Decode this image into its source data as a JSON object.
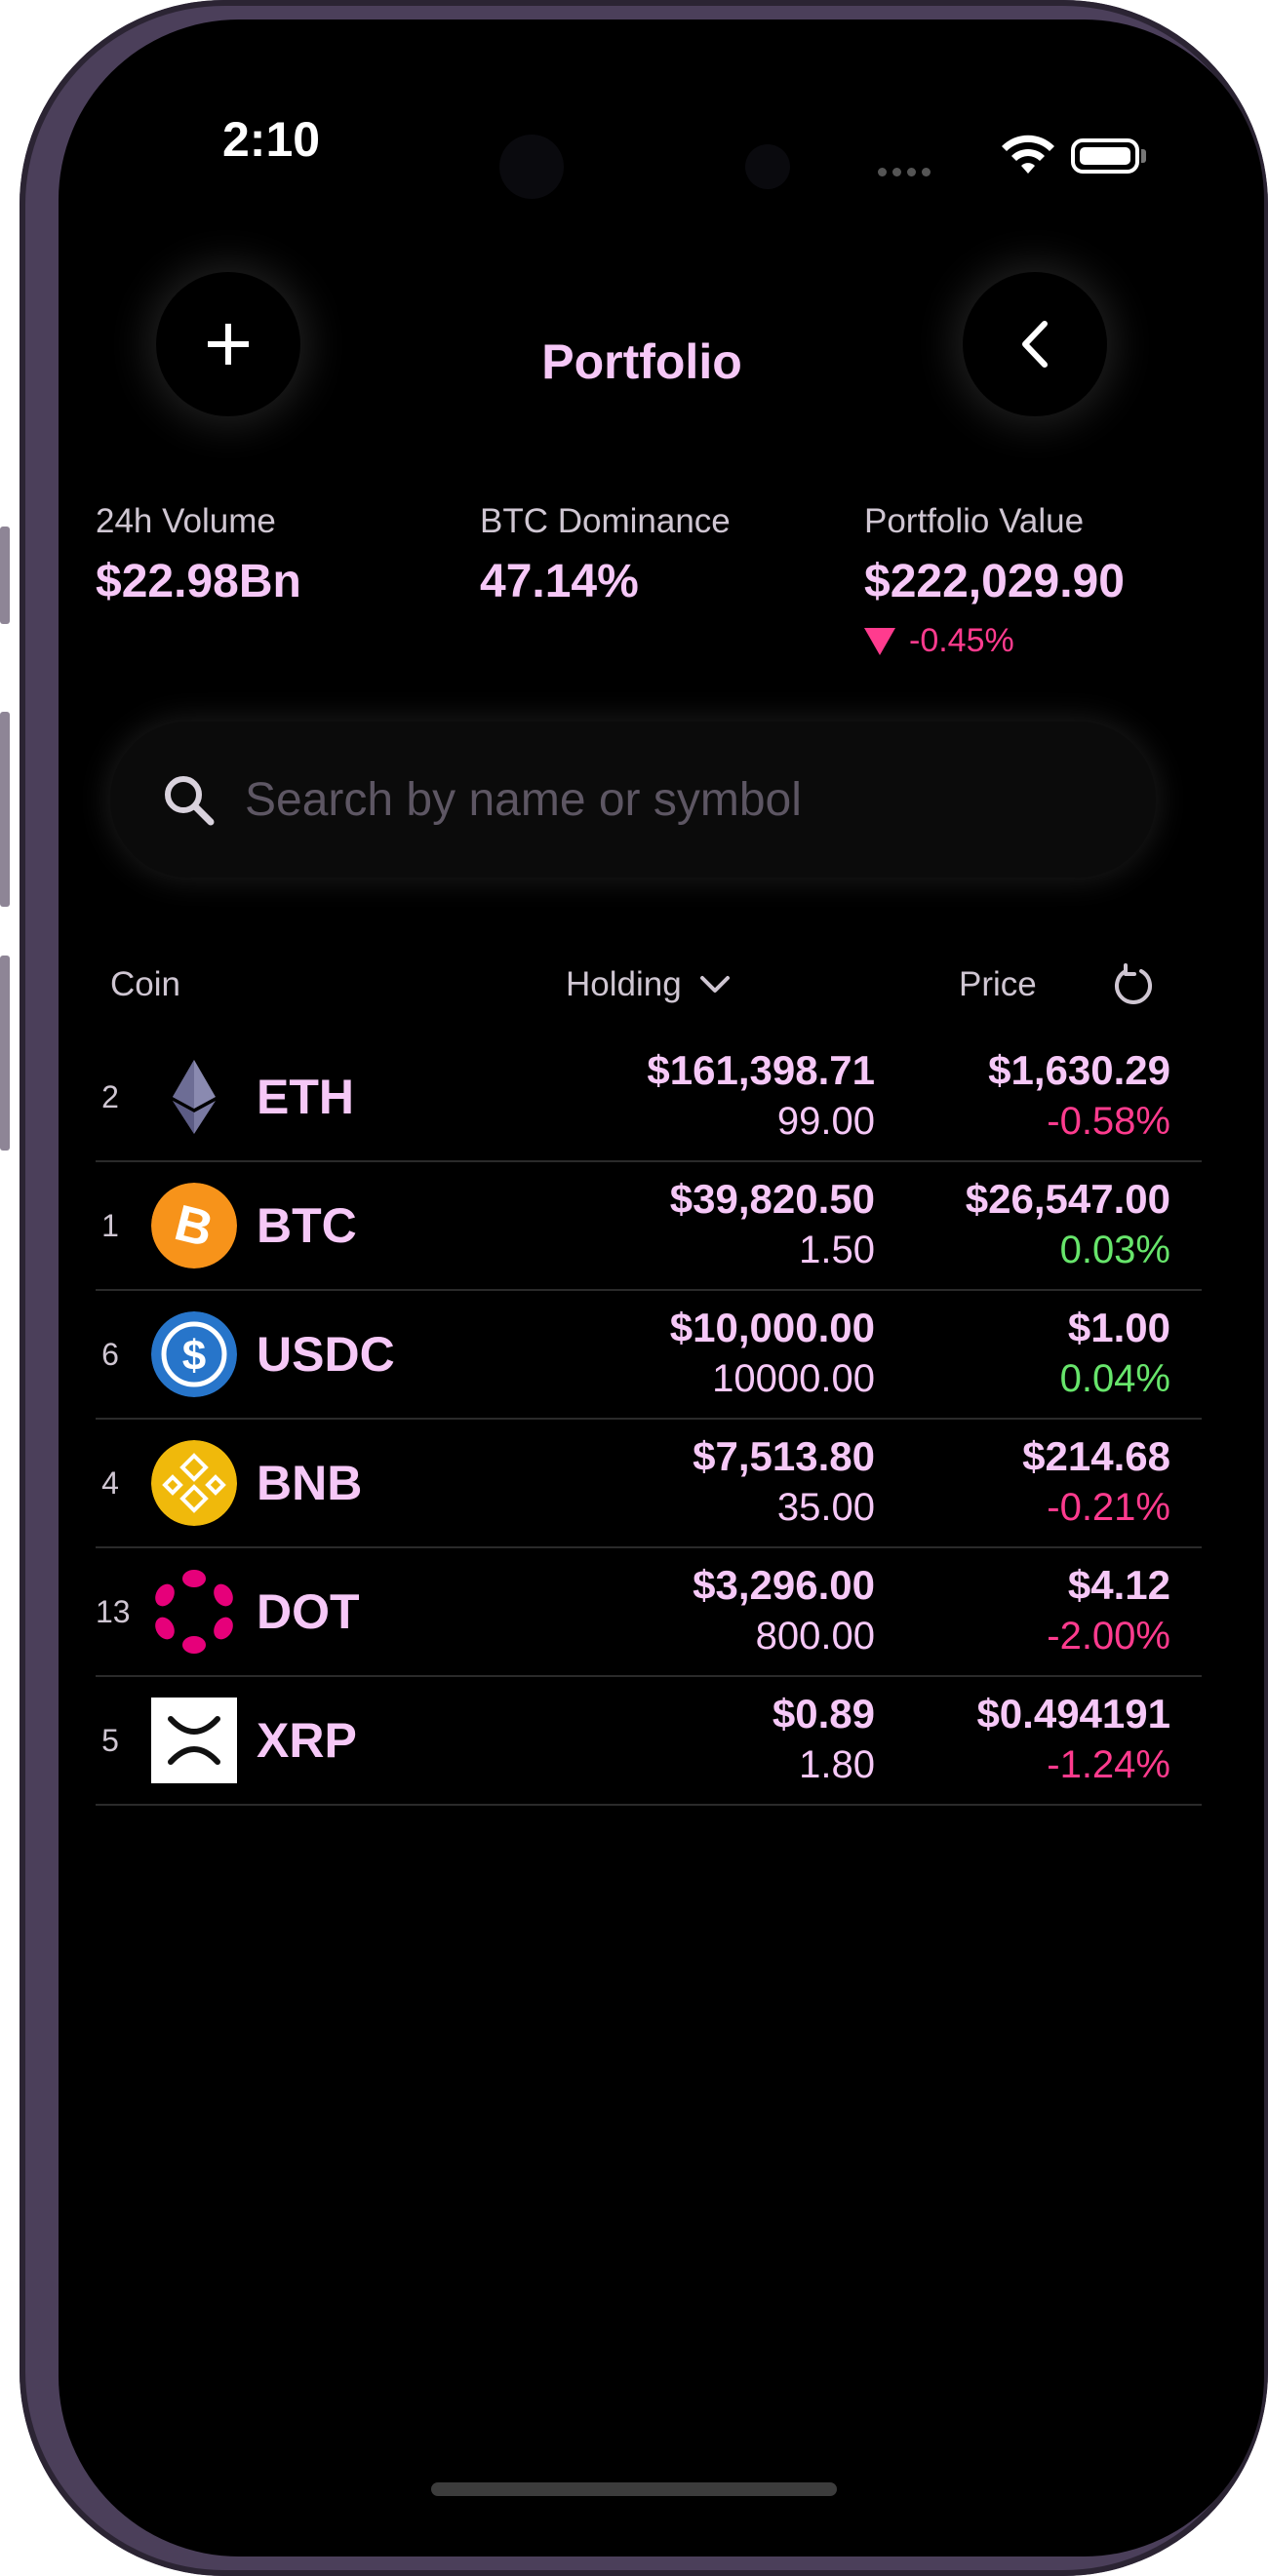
{
  "status": {
    "time": "2:10"
  },
  "header": {
    "title": "Portfolio",
    "add_icon": "plus-icon",
    "back_icon": "chevron-left-icon"
  },
  "stats": {
    "volume_label": "24h Volume",
    "volume_value": "$22.98Bn",
    "dominance_label": "BTC Dominance",
    "dominance_value": "47.14%",
    "portfolio_label": "Portfolio Value",
    "portfolio_value": "$222,029.90",
    "portfolio_change": "-0.45%"
  },
  "search": {
    "placeholder": "Search by name or symbol"
  },
  "columns": {
    "coin": "Coin",
    "holding": "Holding",
    "price": "Price"
  },
  "colors": {
    "accent": "#f6c8f7",
    "negative": "#ff3b8e",
    "positive": "#67e56b",
    "background": "#000000"
  },
  "coins": [
    {
      "rank": "2",
      "symbol": "ETH",
      "icon": "ethereum-icon",
      "holding_value": "$161,398.71",
      "holding_amount": "99.00",
      "price": "$1,630.29",
      "change": "-0.58%",
      "direction": "neg"
    },
    {
      "rank": "1",
      "symbol": "BTC",
      "icon": "bitcoin-icon",
      "holding_value": "$39,820.50",
      "holding_amount": "1.50",
      "price": "$26,547.00",
      "change": "0.03%",
      "direction": "pos"
    },
    {
      "rank": "6",
      "symbol": "USDC",
      "icon": "usdc-icon",
      "holding_value": "$10,000.00",
      "holding_amount": "10000.00",
      "price": "$1.00",
      "change": "0.04%",
      "direction": "pos"
    },
    {
      "rank": "4",
      "symbol": "BNB",
      "icon": "bnb-icon",
      "holding_value": "$7,513.80",
      "holding_amount": "35.00",
      "price": "$214.68",
      "change": "-0.21%",
      "direction": "neg"
    },
    {
      "rank": "13",
      "symbol": "DOT",
      "icon": "polkadot-icon",
      "holding_value": "$3,296.00",
      "holding_amount": "800.00",
      "price": "$4.12",
      "change": "-2.00%",
      "direction": "neg"
    },
    {
      "rank": "5",
      "symbol": "XRP",
      "icon": "xrp-icon",
      "holding_value": "$0.89",
      "holding_amount": "1.80",
      "price": "$0.494191",
      "change": "-1.24%",
      "direction": "neg"
    }
  ]
}
